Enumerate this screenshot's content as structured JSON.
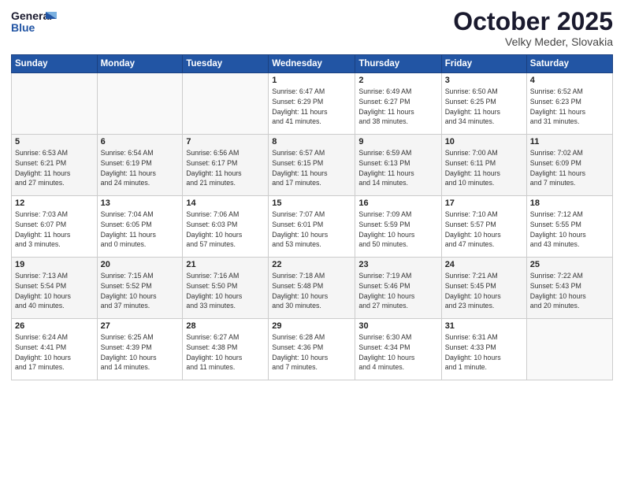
{
  "header": {
    "logo_line1": "General",
    "logo_line2": "Blue",
    "month": "October 2025",
    "location": "Velky Meder, Slovakia"
  },
  "weekdays": [
    "Sunday",
    "Monday",
    "Tuesday",
    "Wednesday",
    "Thursday",
    "Friday",
    "Saturday"
  ],
  "weeks": [
    [
      {
        "day": "",
        "info": ""
      },
      {
        "day": "",
        "info": ""
      },
      {
        "day": "",
        "info": ""
      },
      {
        "day": "1",
        "info": "Sunrise: 6:47 AM\nSunset: 6:29 PM\nDaylight: 11 hours\nand 41 minutes."
      },
      {
        "day": "2",
        "info": "Sunrise: 6:49 AM\nSunset: 6:27 PM\nDaylight: 11 hours\nand 38 minutes."
      },
      {
        "day": "3",
        "info": "Sunrise: 6:50 AM\nSunset: 6:25 PM\nDaylight: 11 hours\nand 34 minutes."
      },
      {
        "day": "4",
        "info": "Sunrise: 6:52 AM\nSunset: 6:23 PM\nDaylight: 11 hours\nand 31 minutes."
      }
    ],
    [
      {
        "day": "5",
        "info": "Sunrise: 6:53 AM\nSunset: 6:21 PM\nDaylight: 11 hours\nand 27 minutes."
      },
      {
        "day": "6",
        "info": "Sunrise: 6:54 AM\nSunset: 6:19 PM\nDaylight: 11 hours\nand 24 minutes."
      },
      {
        "day": "7",
        "info": "Sunrise: 6:56 AM\nSunset: 6:17 PM\nDaylight: 11 hours\nand 21 minutes."
      },
      {
        "day": "8",
        "info": "Sunrise: 6:57 AM\nSunset: 6:15 PM\nDaylight: 11 hours\nand 17 minutes."
      },
      {
        "day": "9",
        "info": "Sunrise: 6:59 AM\nSunset: 6:13 PM\nDaylight: 11 hours\nand 14 minutes."
      },
      {
        "day": "10",
        "info": "Sunrise: 7:00 AM\nSunset: 6:11 PM\nDaylight: 11 hours\nand 10 minutes."
      },
      {
        "day": "11",
        "info": "Sunrise: 7:02 AM\nSunset: 6:09 PM\nDaylight: 11 hours\nand 7 minutes."
      }
    ],
    [
      {
        "day": "12",
        "info": "Sunrise: 7:03 AM\nSunset: 6:07 PM\nDaylight: 11 hours\nand 3 minutes."
      },
      {
        "day": "13",
        "info": "Sunrise: 7:04 AM\nSunset: 6:05 PM\nDaylight: 11 hours\nand 0 minutes."
      },
      {
        "day": "14",
        "info": "Sunrise: 7:06 AM\nSunset: 6:03 PM\nDaylight: 10 hours\nand 57 minutes."
      },
      {
        "day": "15",
        "info": "Sunrise: 7:07 AM\nSunset: 6:01 PM\nDaylight: 10 hours\nand 53 minutes."
      },
      {
        "day": "16",
        "info": "Sunrise: 7:09 AM\nSunset: 5:59 PM\nDaylight: 10 hours\nand 50 minutes."
      },
      {
        "day": "17",
        "info": "Sunrise: 7:10 AM\nSunset: 5:57 PM\nDaylight: 10 hours\nand 47 minutes."
      },
      {
        "day": "18",
        "info": "Sunrise: 7:12 AM\nSunset: 5:55 PM\nDaylight: 10 hours\nand 43 minutes."
      }
    ],
    [
      {
        "day": "19",
        "info": "Sunrise: 7:13 AM\nSunset: 5:54 PM\nDaylight: 10 hours\nand 40 minutes."
      },
      {
        "day": "20",
        "info": "Sunrise: 7:15 AM\nSunset: 5:52 PM\nDaylight: 10 hours\nand 37 minutes."
      },
      {
        "day": "21",
        "info": "Sunrise: 7:16 AM\nSunset: 5:50 PM\nDaylight: 10 hours\nand 33 minutes."
      },
      {
        "day": "22",
        "info": "Sunrise: 7:18 AM\nSunset: 5:48 PM\nDaylight: 10 hours\nand 30 minutes."
      },
      {
        "day": "23",
        "info": "Sunrise: 7:19 AM\nSunset: 5:46 PM\nDaylight: 10 hours\nand 27 minutes."
      },
      {
        "day": "24",
        "info": "Sunrise: 7:21 AM\nSunset: 5:45 PM\nDaylight: 10 hours\nand 23 minutes."
      },
      {
        "day": "25",
        "info": "Sunrise: 7:22 AM\nSunset: 5:43 PM\nDaylight: 10 hours\nand 20 minutes."
      }
    ],
    [
      {
        "day": "26",
        "info": "Sunrise: 6:24 AM\nSunset: 4:41 PM\nDaylight: 10 hours\nand 17 minutes."
      },
      {
        "day": "27",
        "info": "Sunrise: 6:25 AM\nSunset: 4:39 PM\nDaylight: 10 hours\nand 14 minutes."
      },
      {
        "day": "28",
        "info": "Sunrise: 6:27 AM\nSunset: 4:38 PM\nDaylight: 10 hours\nand 11 minutes."
      },
      {
        "day": "29",
        "info": "Sunrise: 6:28 AM\nSunset: 4:36 PM\nDaylight: 10 hours\nand 7 minutes."
      },
      {
        "day": "30",
        "info": "Sunrise: 6:30 AM\nSunset: 4:34 PM\nDaylight: 10 hours\nand 4 minutes."
      },
      {
        "day": "31",
        "info": "Sunrise: 6:31 AM\nSunset: 4:33 PM\nDaylight: 10 hours\nand 1 minute."
      },
      {
        "day": "",
        "info": ""
      }
    ]
  ]
}
